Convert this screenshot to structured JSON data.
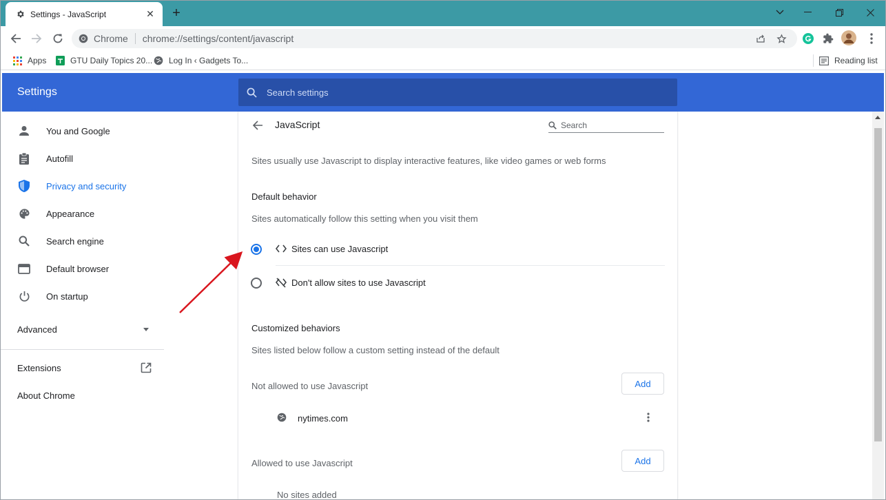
{
  "browser": {
    "tab_title": "Settings - JavaScript",
    "omnibox": {
      "site_label": "Chrome",
      "url": "chrome://settings/content/javascript"
    },
    "bookmarks": [
      {
        "label": "Apps",
        "icon": "apps-grid-icon"
      },
      {
        "label": "GTU Daily Topics 20...",
        "icon": "sheets-icon"
      },
      {
        "label": "Log In ‹ Gadgets To...",
        "icon": "globe-icon"
      }
    ],
    "reading_list": "Reading list"
  },
  "settings": {
    "header_title": "Settings",
    "search_placeholder": "Search settings",
    "nav": {
      "items": [
        {
          "label": "You and Google",
          "icon": "person-icon"
        },
        {
          "label": "Autofill",
          "icon": "clipboard-icon"
        },
        {
          "label": "Privacy and security",
          "icon": "shield-icon",
          "active": true
        },
        {
          "label": "Appearance",
          "icon": "palette-icon"
        },
        {
          "label": "Search engine",
          "icon": "search-icon"
        },
        {
          "label": "Default browser",
          "icon": "browser-window-icon"
        },
        {
          "label": "On startup",
          "icon": "power-icon"
        }
      ],
      "advanced": "Advanced",
      "extensions": "Extensions",
      "about": "About Chrome"
    },
    "page": {
      "title": "JavaScript",
      "search_placeholder": "Search",
      "description": "Sites usually use Javascript to display interactive features, like video games or web forms",
      "default_behavior": {
        "heading": "Default behavior",
        "subtext": "Sites automatically follow this setting when you visit them",
        "options": [
          {
            "label": "Sites can use Javascript",
            "selected": true,
            "icon": "code-brackets-icon"
          },
          {
            "label": "Don't allow sites to use Javascript",
            "selected": false,
            "icon": "code-off-icon"
          }
        ]
      },
      "customized": {
        "heading": "Customized behaviors",
        "subtext": "Sites listed below follow a custom setting instead of the default",
        "not_allowed": {
          "label": "Not allowed to use Javascript",
          "add": "Add",
          "sites": [
            "nytimes.com"
          ]
        },
        "allowed": {
          "label": "Allowed to use Javascript",
          "add": "Add",
          "empty": "No sites added"
        }
      }
    }
  },
  "colors": {
    "accent": "#1a73e8",
    "header": "#3367d6",
    "titlebar": "#3c9aa5",
    "arrow": "#d9161e"
  }
}
